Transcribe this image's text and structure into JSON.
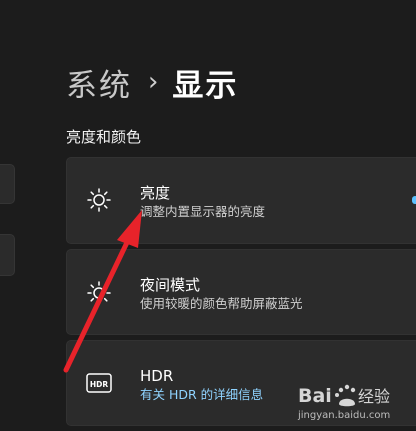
{
  "breadcrumb": {
    "parent": "系统",
    "separator": "›",
    "current": "显示"
  },
  "section": {
    "title": "亮度和颜色"
  },
  "cards": {
    "brightness": {
      "title": "亮度",
      "subtitle": "调整内置显示器的亮度",
      "icon": "sun-icon"
    },
    "night_light": {
      "title": "夜间模式",
      "subtitle": "使用较暖的颜色帮助屏蔽蓝光",
      "icon": "sun-outline-icon"
    },
    "hdr": {
      "title": "HDR",
      "link": "有关 HDR 的详细信息",
      "icon": "hdr-icon"
    }
  },
  "watermark": {
    "url": "jingyan.baidu.com"
  },
  "colors": {
    "background": "#1c1c1c",
    "card": "#2b2b2b",
    "accent": "#5cc1ff",
    "link": "#8fd3ff",
    "annotation_arrow": "#e8232a"
  }
}
